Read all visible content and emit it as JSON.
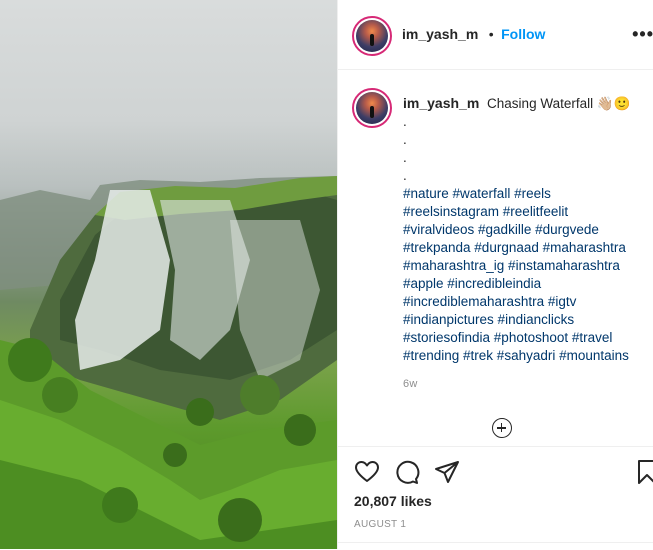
{
  "post": {
    "username": "im_yash_m",
    "separator": "•",
    "follow_label": "Follow",
    "more_label": "•••",
    "caption": {
      "username": "im_yash_m",
      "text": "Chasing Waterfall 👋🏼🙂",
      "dots": [
        ".",
        ".",
        ".",
        "."
      ],
      "hashtag_lines": [
        "#nature #waterfall #reels",
        "#reelsinstagram #reelitfeelit",
        "#viralvideos #gadkille #durgvede",
        "#trekpanda #durgnaad #maharashtra",
        "#maharashtra_ig #instamaharashtra",
        "#apple #incredibleindia",
        "#incrediblemaharashtra #igtv",
        "#indianpictures #indianclicks",
        "#storiesofindia #photoshoot #travel",
        "#trending #trek #sahyadri #mountains"
      ],
      "time_ago": "6w"
    },
    "likes": "20,807 likes",
    "date": "AUGUST 1"
  },
  "icons": {
    "like": "heart-icon",
    "comment": "comment-icon",
    "share": "share-icon",
    "save": "bookmark-icon",
    "load_more": "plus-circle-icon"
  },
  "colors": {
    "link": "#0095f6",
    "hashtag": "#00376b",
    "muted": "#8e8e8e",
    "text": "#262626"
  }
}
